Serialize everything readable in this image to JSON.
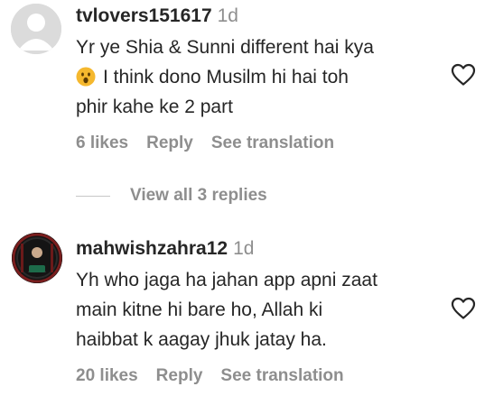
{
  "comments": [
    {
      "username": "tvlovers151617",
      "time": "1d",
      "text_line1": "Yr ye Shia & Sunni different hai kya",
      "text_line2": "I think dono Musilm hi hai toh",
      "text_line3": "phir kahe ke 2 part",
      "emoji": "surprised-face-emoji",
      "likes": "6 likes",
      "reply": "Reply",
      "translation": "See translation"
    },
    {
      "username": "mahwishzahra12",
      "time": "1d",
      "text_line1": "Yh who jaga ha jahan app apni zaat",
      "text_line2": "main kitne hi bare ho, Allah ki",
      "text_line3": "haibbat k aagay jhuk jatay ha.",
      "likes": "20 likes",
      "reply": "Reply",
      "translation": "See translation"
    }
  ],
  "view_replies": "View all 3 replies",
  "icons": {
    "like": "heart-outline-icon"
  },
  "colors": {
    "text": "#262626",
    "secondary": "#8e8e8e",
    "avatar_placeholder": "#dbdbdb",
    "emoji": "#f5b82e"
  }
}
